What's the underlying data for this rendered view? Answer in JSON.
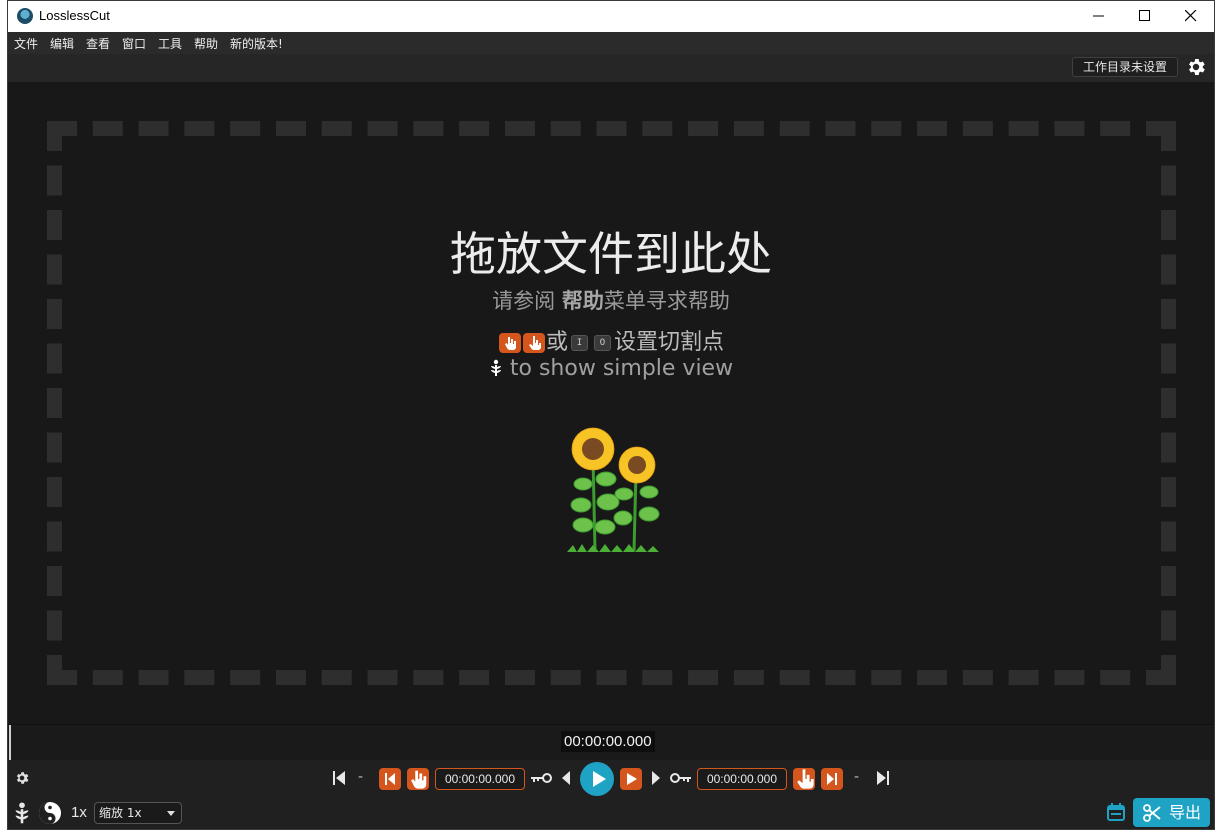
{
  "window": {
    "title": "LosslessCut"
  },
  "menu": [
    {
      "label": "文件"
    },
    {
      "label": "编辑"
    },
    {
      "label": "查看"
    },
    {
      "label": "窗口"
    },
    {
      "label": "工具"
    },
    {
      "label": "帮助"
    },
    {
      "label": "新的版本!"
    }
  ],
  "topbar": {
    "workdir_label": "工作目录未设置",
    "settings_icon": "gear-icon"
  },
  "dropzone": {
    "title": "拖放文件到此处",
    "help_prefix": "请参阅 ",
    "help_bold": "帮助",
    "help_suffix": "菜单寻求帮助",
    "cut_or": "或",
    "key_in": "I",
    "key_out": "O",
    "cut_suffix": "设置切割点",
    "simple_view": " to show simple view",
    "illustration": "sunflower-icon"
  },
  "timeline": {
    "current_time": "00:00:00.000"
  },
  "controls": {
    "start_dash": "-",
    "cut_start_time": "00:00:00.000",
    "cut_end_time": "00:00:00.000",
    "end_dash": "-",
    "speed": "1x",
    "zoom_value": "缩放 1x",
    "export_label": "导出"
  },
  "colors": {
    "accent": "#1ea3c4",
    "cut_orange": "#d4561d",
    "background": "#181818"
  }
}
